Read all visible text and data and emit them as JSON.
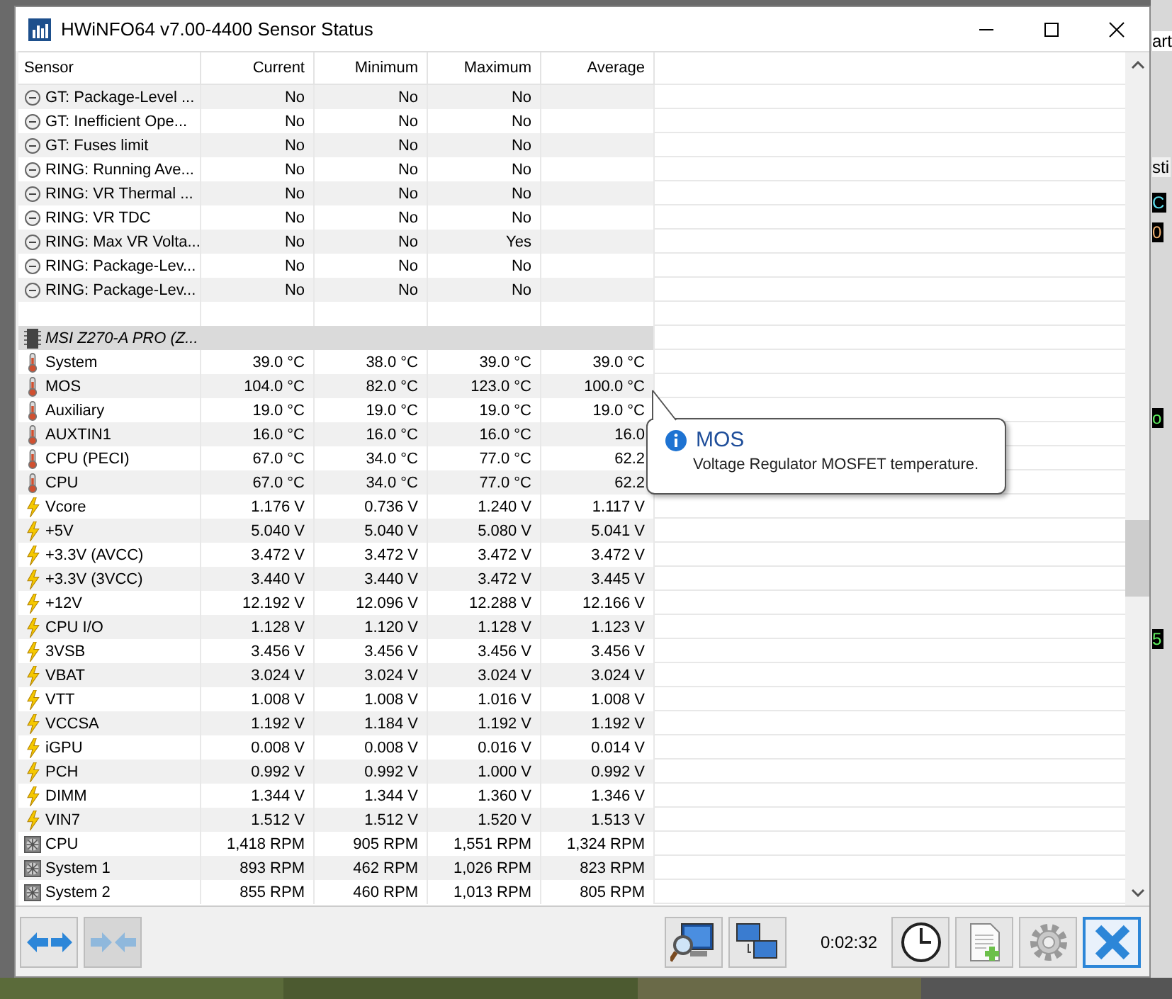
{
  "window": {
    "title": "HWiNFO64 v7.00-4400 Sensor Status"
  },
  "table": {
    "columns": [
      "Sensor",
      "Current",
      "Minimum",
      "Maximum",
      "Average"
    ],
    "rows": [
      {
        "kind": "flag",
        "cells": [
          "GT: Package-Level ...",
          "No",
          "No",
          "No",
          ""
        ]
      },
      {
        "kind": "flag",
        "cells": [
          "GT: Inefficient Ope...",
          "No",
          "No",
          "No",
          ""
        ]
      },
      {
        "kind": "flag",
        "cells": [
          "GT: Fuses limit",
          "No",
          "No",
          "No",
          ""
        ]
      },
      {
        "kind": "flag",
        "cells": [
          "RING: Running Ave...",
          "No",
          "No",
          "No",
          ""
        ]
      },
      {
        "kind": "flag",
        "cells": [
          "RING: VR Thermal ...",
          "No",
          "No",
          "No",
          ""
        ]
      },
      {
        "kind": "flag",
        "cells": [
          "RING: VR TDC",
          "No",
          "No",
          "No",
          ""
        ]
      },
      {
        "kind": "flag",
        "cells": [
          "RING: Max VR Volta...",
          "No",
          "No",
          "Yes",
          ""
        ]
      },
      {
        "kind": "flag",
        "cells": [
          "RING: Package-Lev...",
          "No",
          "No",
          "No",
          ""
        ]
      },
      {
        "kind": "flag",
        "cells": [
          "RING: Package-Lev...",
          "No",
          "No",
          "No",
          ""
        ]
      },
      {
        "kind": "blank",
        "cells": []
      },
      {
        "kind": "group",
        "cells": [
          "MSI Z270-A PRO (Z..."
        ]
      },
      {
        "kind": "temperature",
        "cells": [
          "System",
          "39.0 °C",
          "38.0 °C",
          "39.0 °C",
          "39.0 °C"
        ]
      },
      {
        "kind": "temperature",
        "cells": [
          "MOS",
          "104.0 °C",
          "82.0 °C",
          "123.0 °C",
          "100.0 °C"
        ]
      },
      {
        "kind": "temperature",
        "cells": [
          "Auxiliary",
          "19.0 °C",
          "19.0 °C",
          "19.0 °C",
          "19.0 °C"
        ]
      },
      {
        "kind": "temperature",
        "cells": [
          "AUXTIN1",
          "16.0 °C",
          "16.0 °C",
          "16.0 °C",
          "16.0"
        ]
      },
      {
        "kind": "temperature",
        "cells": [
          "CPU (PECI)",
          "67.0 °C",
          "34.0 °C",
          "77.0 °C",
          "62.2"
        ]
      },
      {
        "kind": "temperature",
        "cells": [
          "CPU",
          "67.0 °C",
          "34.0 °C",
          "77.0 °C",
          "62.2"
        ]
      },
      {
        "kind": "voltage",
        "cells": [
          "Vcore",
          "1.176 V",
          "0.736 V",
          "1.240 V",
          "1.117 V"
        ]
      },
      {
        "kind": "voltage",
        "cells": [
          "+5V",
          "5.040 V",
          "5.040 V",
          "5.080 V",
          "5.041 V"
        ]
      },
      {
        "kind": "voltage",
        "cells": [
          "+3.3V (AVCC)",
          "3.472 V",
          "3.472 V",
          "3.472 V",
          "3.472 V"
        ]
      },
      {
        "kind": "voltage",
        "cells": [
          "+3.3V (3VCC)",
          "3.440 V",
          "3.440 V",
          "3.472 V",
          "3.445 V"
        ]
      },
      {
        "kind": "voltage",
        "cells": [
          "+12V",
          "12.192 V",
          "12.096 V",
          "12.288 V",
          "12.166 V"
        ]
      },
      {
        "kind": "voltage",
        "cells": [
          "CPU I/O",
          "1.128 V",
          "1.120 V",
          "1.128 V",
          "1.123 V"
        ]
      },
      {
        "kind": "voltage",
        "cells": [
          "3VSB",
          "3.456 V",
          "3.456 V",
          "3.456 V",
          "3.456 V"
        ]
      },
      {
        "kind": "voltage",
        "cells": [
          "VBAT",
          "3.024 V",
          "3.024 V",
          "3.024 V",
          "3.024 V"
        ]
      },
      {
        "kind": "voltage",
        "cells": [
          "VTT",
          "1.008 V",
          "1.008 V",
          "1.016 V",
          "1.008 V"
        ]
      },
      {
        "kind": "voltage",
        "cells": [
          "VCCSA",
          "1.192 V",
          "1.184 V",
          "1.192 V",
          "1.192 V"
        ]
      },
      {
        "kind": "voltage",
        "cells": [
          "iGPU",
          "0.008 V",
          "0.008 V",
          "0.016 V",
          "0.014 V"
        ]
      },
      {
        "kind": "voltage",
        "cells": [
          "PCH",
          "0.992 V",
          "0.992 V",
          "1.000 V",
          "0.992 V"
        ]
      },
      {
        "kind": "voltage",
        "cells": [
          "DIMM",
          "1.344 V",
          "1.344 V",
          "1.360 V",
          "1.346 V"
        ]
      },
      {
        "kind": "voltage",
        "cells": [
          "VIN7",
          "1.512 V",
          "1.512 V",
          "1.520 V",
          "1.513 V"
        ]
      },
      {
        "kind": "fan",
        "cells": [
          "CPU",
          "1,418 RPM",
          "905 RPM",
          "1,551 RPM",
          "1,324 RPM"
        ]
      },
      {
        "kind": "fan",
        "cells": [
          "System 1",
          "893 RPM",
          "462 RPM",
          "1,026 RPM",
          "823 RPM"
        ]
      },
      {
        "kind": "fan",
        "cells": [
          "System 2",
          "855 RPM",
          "460 RPM",
          "1,013 RPM",
          "805 RPM"
        ]
      }
    ]
  },
  "tooltip": {
    "title": "MOS",
    "text": "Voltage Regulator MOSFET temperature."
  },
  "toolbar": {
    "left_buttons": [
      {
        "kind": "expand",
        "disabled": false
      },
      {
        "kind": "collapse",
        "disabled": true
      }
    ],
    "right_buttons": [
      {
        "kind": "monitor-search"
      },
      {
        "kind": "network"
      }
    ],
    "elapsed": "0:02:32",
    "end_buttons": [
      {
        "kind": "clock",
        "selected": false
      },
      {
        "kind": "report",
        "selected": false
      },
      {
        "kind": "settings",
        "selected": false
      },
      {
        "kind": "close",
        "selected": true
      }
    ]
  },
  "background_fragments": [
    {
      "text": "art"
    },
    {
      "text": "sti"
    },
    {
      "text": "C"
    },
    {
      "text": "0"
    },
    {
      "text": "o"
    },
    {
      "text": "5"
    }
  ]
}
